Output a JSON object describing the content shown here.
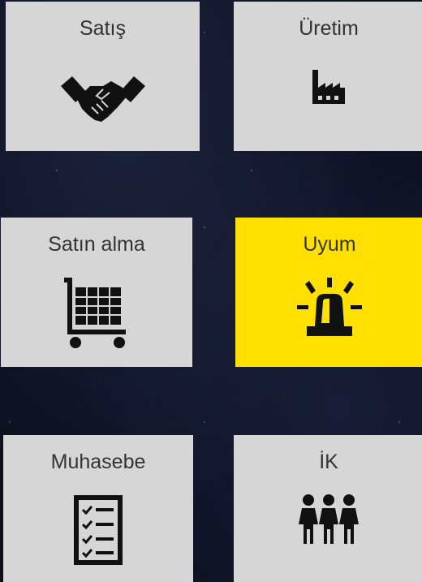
{
  "tiles": [
    {
      "label": "Satış",
      "icon": "handshake-icon",
      "active": false
    },
    {
      "label": "Üretim",
      "icon": "factory-icon",
      "active": false
    },
    {
      "label": "Satın alma",
      "icon": "shopping-cart-icon",
      "active": false
    },
    {
      "label": "Uyum",
      "icon": "siren-icon",
      "active": true
    },
    {
      "label": "Muhasebe",
      "icon": "checklist-icon",
      "active": false
    },
    {
      "label": "İK",
      "icon": "people-icon",
      "active": false
    }
  ],
  "colors": {
    "tile": "#d6d6d6",
    "active_tile": "#ffe000",
    "icon": "#111111",
    "background": "#0c1020"
  }
}
